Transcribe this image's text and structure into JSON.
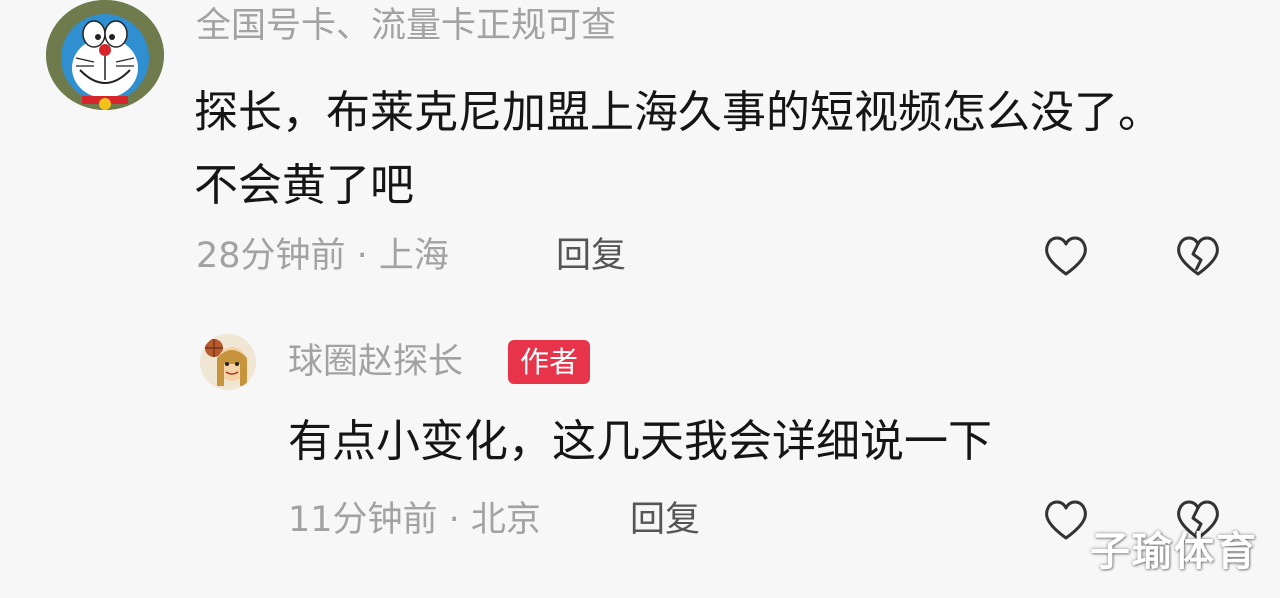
{
  "colors": {
    "author_badge": "#e8344a",
    "muted_text": "#a2a2a2",
    "body_text": "#151515"
  },
  "comments": [
    {
      "avatar_icon": "doraemon-avatar",
      "author": "全国号卡、流量卡正规可查",
      "text": "探长，布莱克尼加盟上海久事的短视频怎么没了。不会黄了吧",
      "meta": "28分钟前 · 上海",
      "reply_label": "回复",
      "like_icon": "heart-outline-icon",
      "dislike_icon": "broken-heart-icon"
    },
    {
      "avatar_icon": "cartoon-basketball-avatar",
      "author": "球圈赵探长",
      "badge": "作者",
      "text": "有点小变化，这几天我会详细说一下",
      "meta": "11分钟前 · 北京",
      "reply_label": "回复",
      "like_icon": "heart-outline-icon",
      "dislike_icon": "broken-heart-icon"
    }
  ],
  "watermark": "子瑜体育"
}
